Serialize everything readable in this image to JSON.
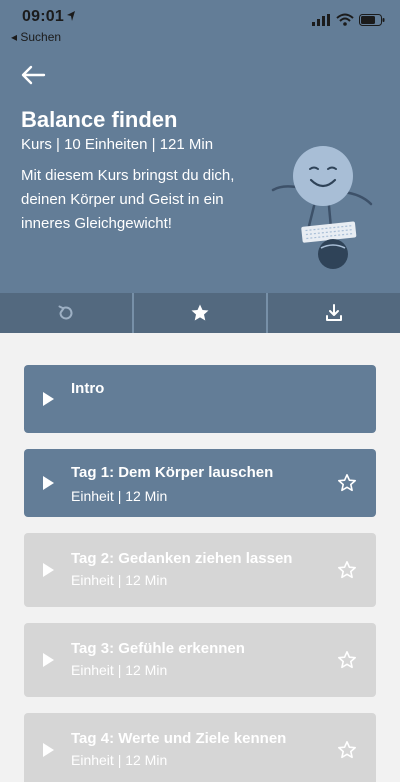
{
  "status_bar": {
    "time": "09:01",
    "back_app": "◂ Suchen"
  },
  "course": {
    "title": "Balance finden",
    "meta": "Kurs | 10 Einheiten | 121 Min",
    "description": "Mit diesem Kurs bringst du dich, deinen Körper und Geist in ein inneres Gleichgewicht!"
  },
  "toolbar": {
    "icons": [
      "restart-icon",
      "star-icon",
      "download-icon"
    ]
  },
  "lessons": [
    {
      "title": "Intro",
      "state": "active"
    },
    {
      "title": "Tag 1: Dem Körper lauschen",
      "subtitle": "Einheit | 12 Min",
      "state": "active"
    },
    {
      "title": "Tag 2: Gedanken ziehen lassen",
      "subtitle": "Einheit | 12 Min",
      "state": "locked"
    },
    {
      "title": "Tag 3: Gefühle erkennen",
      "subtitle": "Einheit | 12 Min",
      "state": "locked"
    },
    {
      "title": "Tag 4: Werte und Ziele kennen",
      "subtitle": "Einheit | 12 Min",
      "state": "locked"
    }
  ],
  "colors": {
    "header": "#637d97",
    "toolbar": "#53697f",
    "locked_card": "#d6d6d6",
    "background": "#f2f2f2"
  }
}
